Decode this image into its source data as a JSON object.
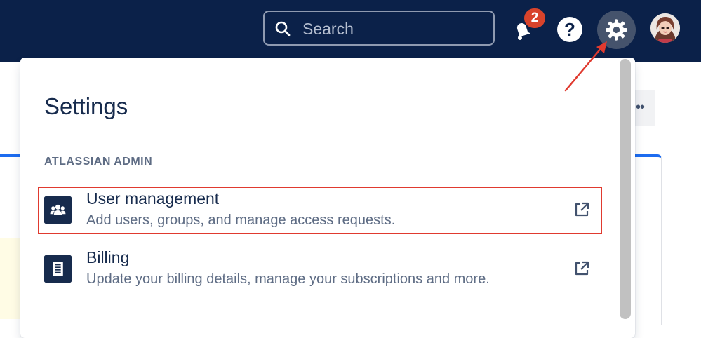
{
  "topbar": {
    "search": {
      "placeholder": "Search",
      "value": ""
    },
    "notifications": {
      "count": "2"
    },
    "help": {
      "label": "?"
    }
  },
  "settings": {
    "title": "Settings",
    "section_heading": "ATLASSIAN ADMIN",
    "items": [
      {
        "title": "User management",
        "description": "Add users, groups, and manage access requests.",
        "icon": "people-icon",
        "external": true,
        "highlighted": true
      },
      {
        "title": "Billing",
        "description": "Update your billing details, manage your subscriptions and more.",
        "icon": "billing-document-icon",
        "external": true,
        "highlighted": false
      }
    ]
  },
  "background": {
    "more_label": "••"
  },
  "colors": {
    "navbar": "#0b2149",
    "badge": "#d8432b",
    "text_primary": "#172b4d",
    "text_secondary": "#5e6c84",
    "annotation": "#e03a2f",
    "accent_blue": "#1d6cf0"
  }
}
